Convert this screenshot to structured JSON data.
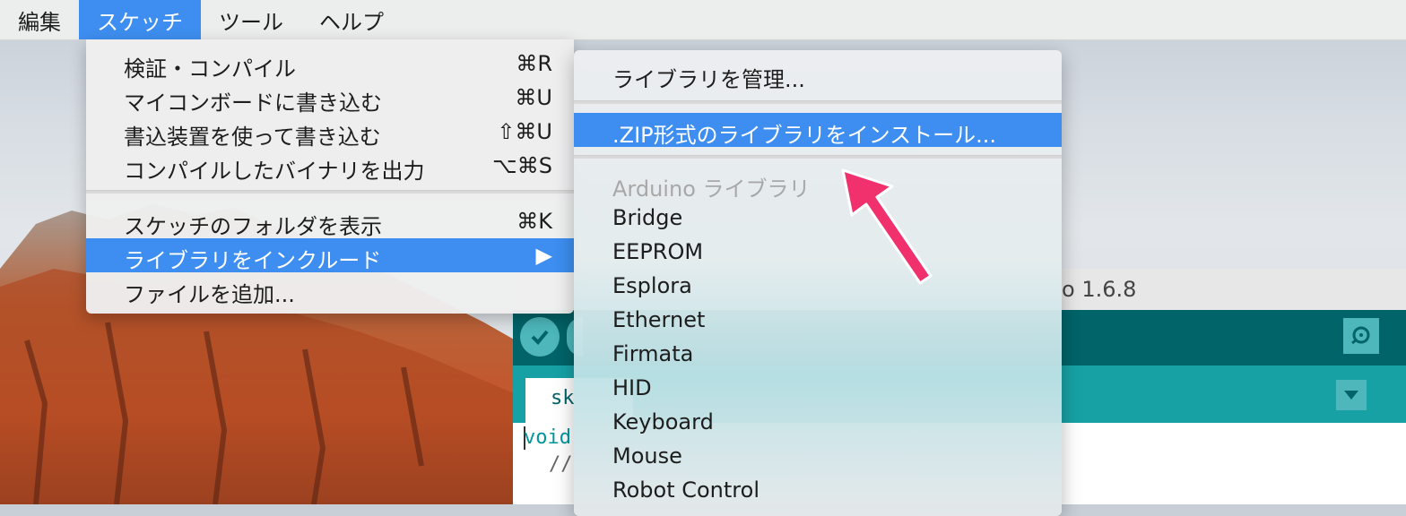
{
  "menubar": {
    "items": [
      "編集",
      "スケッチ",
      "ツール",
      "ヘルプ"
    ],
    "active_index": 1
  },
  "sketch_menu": {
    "items": [
      {
        "label": "検証・コンパイル",
        "shortcut": "⌘R"
      },
      {
        "label": "マイコンボードに書き込む",
        "shortcut": "⌘U"
      },
      {
        "label": "書込装置を使って書き込む",
        "shortcut": "⇧⌘U"
      },
      {
        "label": "コンパイルしたバイナリを出力",
        "shortcut": "⌥⌘S"
      },
      {
        "label": "スケッチのフォルダを表示",
        "shortcut": "⌘K"
      },
      {
        "label": "ライブラリをインクルード",
        "shortcut": "▶"
      },
      {
        "label": "ファイルを追加..."
      }
    ],
    "highlighted_index": 5
  },
  "library_menu": {
    "manage": "ライブラリを管理...",
    "install_zip": ".ZIP形式のライブラリをインストール...",
    "section_header": "Arduino ライブラリ",
    "libraries": [
      "Bridge",
      "EEPROM",
      "Esplora",
      "Ethernet",
      "Firmata",
      "HID",
      "Keyboard",
      "Mouse",
      "Robot Control"
    ]
  },
  "ide": {
    "title_version": "o 1.6.8",
    "tab_name": "sk",
    "code_line1": "void",
    "code_line2": "//"
  },
  "colors": {
    "highlight": "#3d8ef0",
    "arrow": "#f0316e",
    "ide_toolbar": "#006468",
    "ide_tabs": "#17a1a5"
  }
}
